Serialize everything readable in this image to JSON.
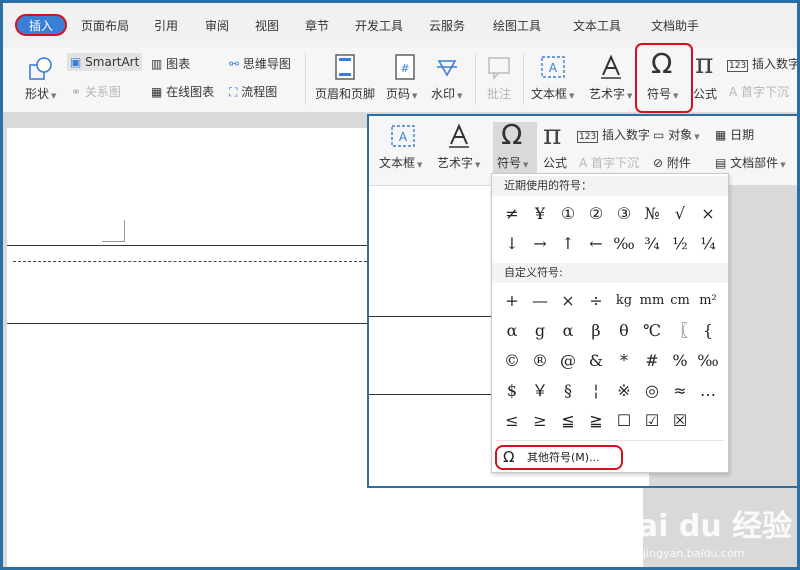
{
  "tabs": [
    "插入",
    "页面布局",
    "引用",
    "审阅",
    "视图",
    "章节",
    "开发工具",
    "云服务",
    "绘图工具",
    "文本工具",
    "文档助手"
  ],
  "ribbon": {
    "shapes": "形状",
    "smartart": "SmartArt",
    "chart": "图表",
    "mindmap": "思维导图",
    "relation": "关系图",
    "online_chart": "在线图表",
    "flowchart": "流程图",
    "header_footer": "页眉和页脚",
    "page_number": "页码",
    "watermark": "水印",
    "comment": "批注",
    "textbox": "文本框",
    "wordart": "艺术字",
    "symbol": "符号",
    "formula": "公式",
    "insert_number": "插入数字",
    "dropcap": "首字下沉"
  },
  "popup": {
    "textbox": "文本框",
    "wordart": "艺术字",
    "symbol": "符号",
    "formula": "公式",
    "insert_number": "插入数字",
    "dropcap": "首字下沉",
    "object": "对象",
    "attachment": "附件",
    "date": "日期",
    "doc_parts": "文档部件"
  },
  "symbols": {
    "recent_label": "近期使用的符号：",
    "recent": [
      "≠",
      "¥",
      "①",
      "②",
      "③",
      "№",
      "√",
      "×",
      "↓",
      "→",
      "↑",
      "←",
      "‰",
      "¾",
      "½",
      "¼"
    ],
    "custom_label": "自定义符号:",
    "custom": [
      "+",
      "—",
      "×",
      "÷",
      "kg",
      "mm",
      "cm",
      "m²",
      "α",
      "g",
      "α",
      "β",
      "θ",
      "℃",
      "〖",
      "{",
      "©",
      "®",
      "@",
      "&",
      "*",
      "#",
      "%",
      "‰",
      "$",
      "￥",
      "§",
      "¦",
      "※",
      "◎",
      "≈",
      "…",
      "≤",
      "≥",
      "≦",
      "≧",
      "☐",
      "☑",
      "☒"
    ],
    "more": "其他符号(M)..."
  },
  "watermark": {
    "brand": "Bai du 经验",
    "site": "jingyan.baidu.com"
  },
  "colors": {
    "accent": "#3a7fd5",
    "highlight": "#d8101e",
    "frame": "#2a6fa6"
  }
}
